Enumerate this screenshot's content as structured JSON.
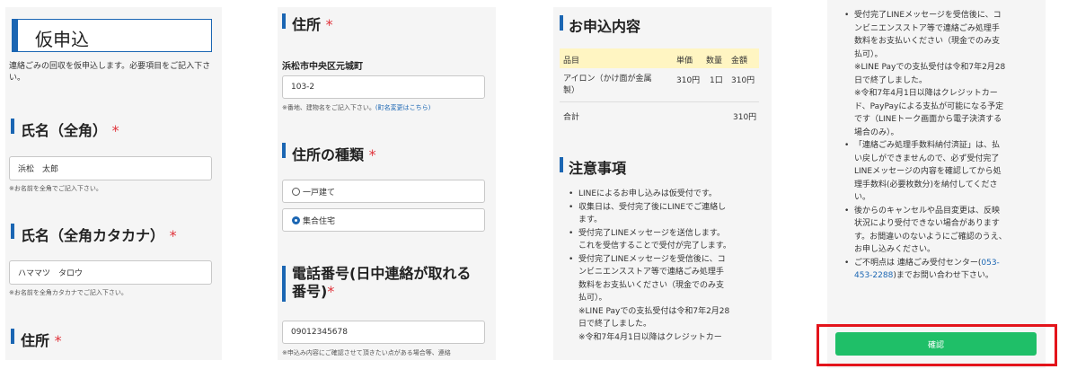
{
  "panel1": {
    "title": "仮申込",
    "intro": "連絡ごみの回収を仮申込します。必要項目をご記入下さい。",
    "name_label": "氏名（全角）",
    "name_value": "浜松　太郎",
    "name_help": "※お名前を全角でご記入下さい。",
    "kana_label": "氏名（全角カタカナ）",
    "kana_value": "ハママツ　タロウ",
    "kana_help": "※お名前を全角カタカナでご記入下さい。",
    "address_label": "住所",
    "required_mark": "*"
  },
  "panel2": {
    "address_label": "住所",
    "city_value": "浜松市中央区元城町",
    "address_value": "103-2",
    "address_help": "※番地、建物名をご記入下さい。",
    "address_link": "(町名変更はこちら)",
    "type_label": "住所の種類",
    "radio_house": "一戸建て",
    "radio_apartment": "集合住宅",
    "phone_label_line1": "電話番号(日中連絡が取れる",
    "phone_label_line2": "番号)",
    "phone_value": "09012345678",
    "phone_help": "※申込み内容にご確認させて頂きたい点がある場合等、連絡",
    "required_mark": "*"
  },
  "panel3": {
    "order_title": "お申込内容",
    "table_headers": [
      "品目",
      "単価",
      "数量",
      "金額"
    ],
    "item_name_line1": "アイロン（かけ面が金属",
    "item_name_line2": "製）",
    "item_price": "310円",
    "item_qty": "1口",
    "item_amount": "310円",
    "total_label": "合計",
    "total_amount": "310円",
    "notes_title": "注意事項",
    "notes": [
      "LINEによるお申し込みは仮受付です。",
      "収集日は、受付完了後にLINEでご連絡し",
      "ます。",
      "受付完了LINEメッセージを送信します。",
      "これを受信することで受付が完了します。",
      "受付完了LINEメッセージを受信後に、コ",
      "ンビニエンスストア等で連絡ごみ処理手",
      "数料をお支払いください（現金でのみ支",
      "払可）。",
      "※LINE Payでの支払受付は令和7年2月28",
      "日で終了しました。",
      "※令和7年4月1日以降はクレジットカー"
    ]
  },
  "panel4": {
    "notes": [
      "受付完了LINEメッセージを受信後に、コ",
      "ンビニエンスストア等で連絡ごみ処理手",
      "数料をお支払いください（現金でのみ支",
      "払可）。",
      "※LINE Payでの支払受付は令和7年2月28",
      "日で終了しました。",
      "※令和7年4月1日以降はクレジットカー",
      "ド、PayPayによる支払が可能になる予定",
      "です（LINEトーク画面から電子決済する",
      "場合のみ）。",
      "「連絡ごみ処理手数料納付済証」は、払",
      "い戻しができませんので、必ず受付完了",
      "LINEメッセージの内容を確認してから処",
      "理手数料(必要枚数分)を納付してくださ",
      "い。",
      "後からのキャンセルや品目変更は、反映",
      "状況により受付できない場合があります",
      "す。お間違いのないようにご確認のうえ、",
      "お申し込みください。",
      "ご不明点は 連絡ごみ受付センター(",
      "453-2288)までお問い合わせ下さい。"
    ],
    "phone_link_part1": "053-",
    "phone_link_part2": "453-2288",
    "last_line_rest": ")までお問い合わせ下さい。",
    "confirm_label": "確認"
  },
  "colors": {
    "accent": "#1b66b3",
    "required": "#e0323a",
    "confirm": "#1fbf68",
    "highlight": "#e3141b",
    "table_header": "#fff5c2"
  }
}
